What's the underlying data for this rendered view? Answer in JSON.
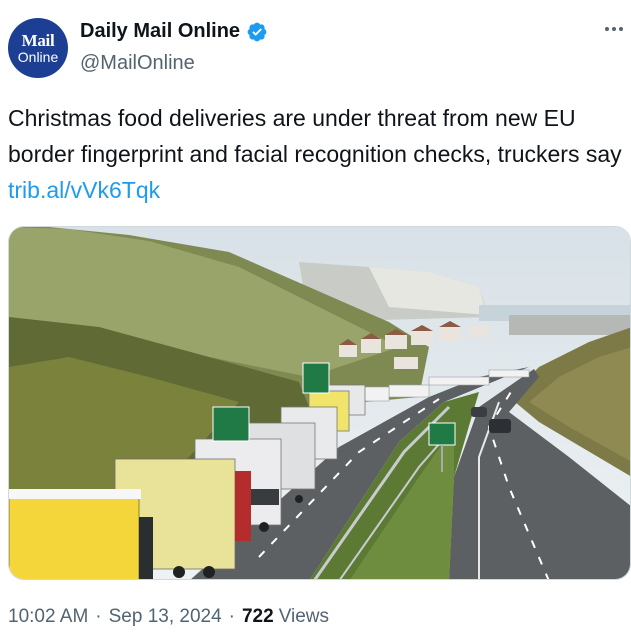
{
  "author": {
    "avatar_line1": "Mail",
    "avatar_line2": "Online",
    "display_name": "Daily Mail Online",
    "handle": "@MailOnline",
    "verified_color": "#1d9bf0",
    "brand_color": "#1c3f94"
  },
  "tweet": {
    "text": "Christmas food deliveries are under threat from new EU border fingerprint and facial recognition checks, truckers say",
    "link": "trib.al/vVk6Tqk",
    "image_description_icon": "photo-of-queued-lorries"
  },
  "meta": {
    "time": "10:02 AM",
    "separator": "·",
    "date": "Sep 13, 2024",
    "views_count": "722",
    "views_label": "Views"
  },
  "colors": {
    "link": "#1d9bf0",
    "secondary_text": "#536471",
    "primary_text": "#0f1419"
  }
}
